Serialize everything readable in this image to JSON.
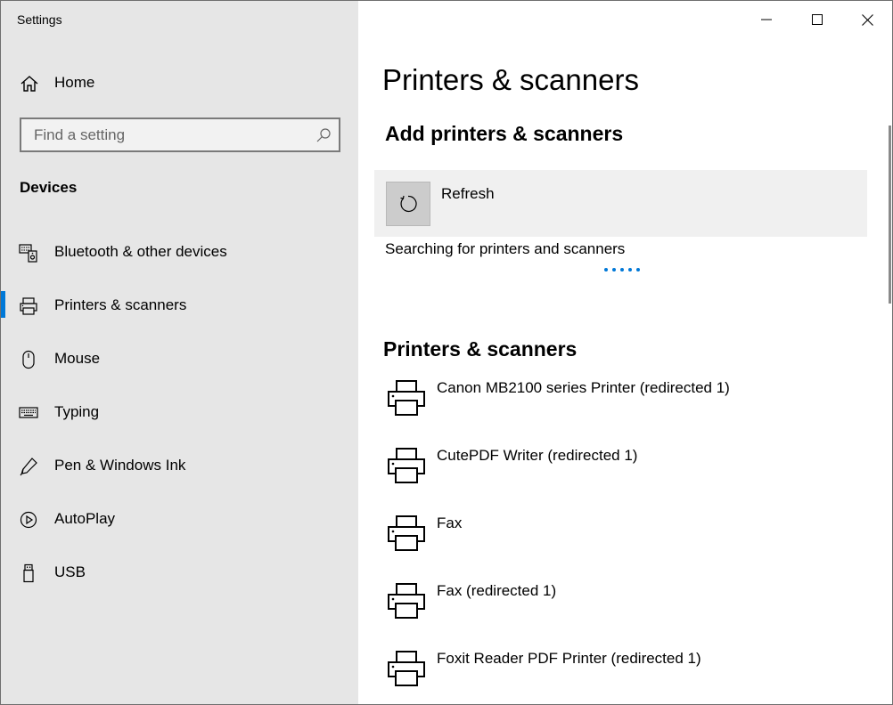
{
  "window": {
    "title": "Settings",
    "controls": {
      "minimize": "minimize-icon",
      "maximize": "maximize-icon",
      "close": "close-icon"
    }
  },
  "sidebar": {
    "home_label": "Home",
    "search_placeholder": "Find a setting",
    "section_title": "Devices",
    "items": [
      {
        "label": "Bluetooth & other devices",
        "icon": "bluetooth-devices-icon",
        "active": false
      },
      {
        "label": "Printers & scanners",
        "icon": "printer-icon",
        "active": true
      },
      {
        "label": "Mouse",
        "icon": "mouse-icon",
        "active": false
      },
      {
        "label": "Typing",
        "icon": "keyboard-icon",
        "active": false
      },
      {
        "label": "Pen & Windows Ink",
        "icon": "pen-icon",
        "active": false
      },
      {
        "label": "AutoPlay",
        "icon": "autoplay-icon",
        "active": false
      },
      {
        "label": "USB",
        "icon": "usb-icon",
        "active": false
      }
    ]
  },
  "main": {
    "page_title": "Printers & scanners",
    "add_section_title": "Add printers & scanners",
    "refresh_label": "Refresh",
    "search_status": "Searching for printers and scanners",
    "list_title": "Printers & scanners",
    "printers": [
      {
        "label": "Canon MB2100 series Printer (redirected 1)"
      },
      {
        "label": "CutePDF Writer (redirected 1)"
      },
      {
        "label": "Fax"
      },
      {
        "label": "Fax (redirected 1)"
      },
      {
        "label": "Foxit Reader PDF Printer (redirected 1)"
      }
    ]
  },
  "colors": {
    "accent": "#0078d7",
    "sidebar_bg": "#e6e6e6",
    "refresh_row_bg": "#f0f0f0"
  }
}
